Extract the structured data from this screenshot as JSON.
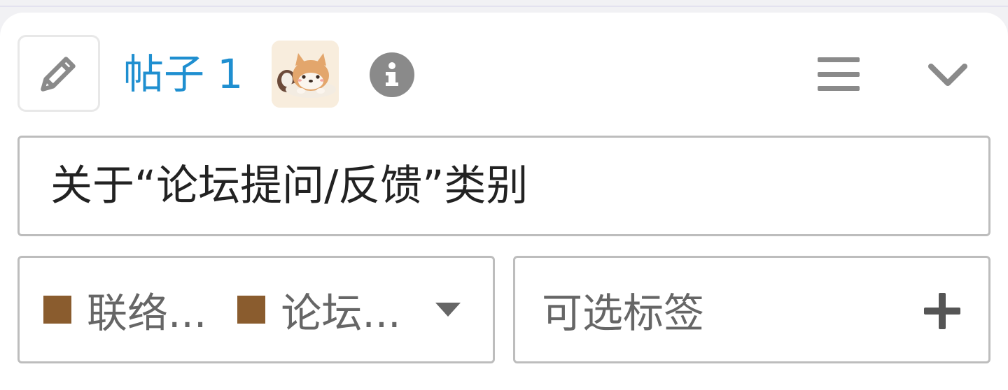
{
  "post": {
    "title": "帖子 1",
    "avatar_icon": "shiba-dog-avatar",
    "info_icon": "info-icon",
    "menu_icon": "menu-icon",
    "collapse_icon": "chevron-down-icon",
    "edit_icon": "pencil-icon"
  },
  "topic_title": {
    "value": "关于“论坛提问/反馈”类别"
  },
  "categories": {
    "selected": [
      {
        "label": "联络...",
        "color": "#8a5c2e"
      },
      {
        "label": "论坛...",
        "color": "#8a5c2e"
      }
    ],
    "dropdown_icon": "caret-down-icon"
  },
  "tags": {
    "placeholder": "可选标签",
    "add_icon": "plus-icon"
  },
  "colors": {
    "accent": "#1f8fd0",
    "icon_gray": "#8a8a8a",
    "border": "#bdbdbd",
    "category_color": "#8a5c2e"
  }
}
